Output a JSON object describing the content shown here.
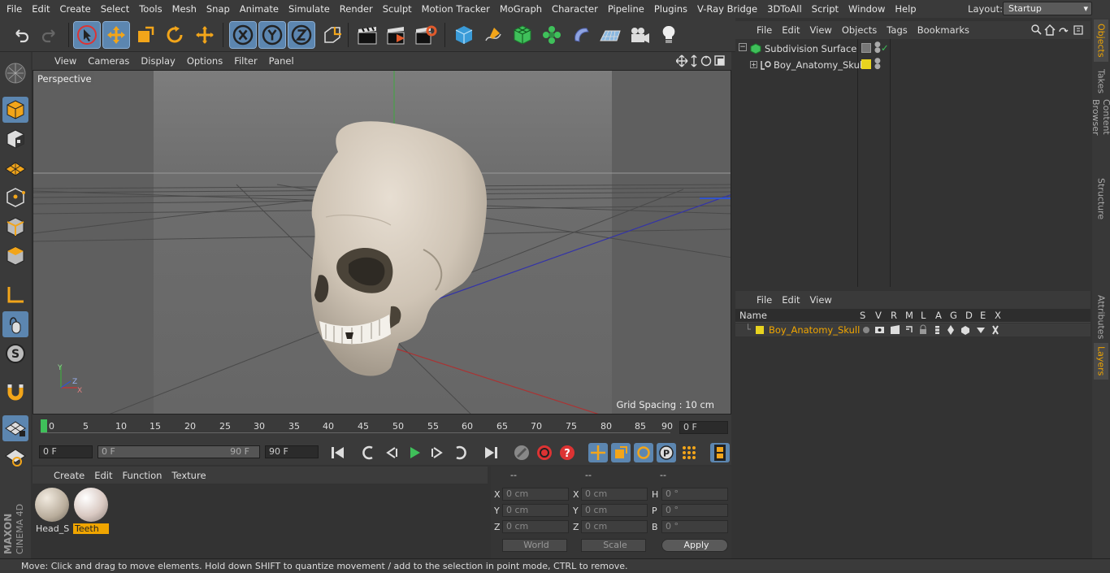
{
  "menubar": {
    "items": [
      "File",
      "Edit",
      "Create",
      "Select",
      "Tools",
      "Mesh",
      "Snap",
      "Animate",
      "Simulate",
      "Render",
      "Sculpt",
      "Motion Tracker",
      "MoGraph",
      "Character",
      "Pipeline",
      "Plugins",
      "V-Ray Bridge",
      "3DToAll",
      "Script",
      "Window",
      "Help"
    ],
    "layout_label": "Layout:",
    "layout_value": "Startup"
  },
  "viewport": {
    "menu": [
      "View",
      "Cameras",
      "Display",
      "Options",
      "Filter",
      "Panel"
    ],
    "camera": "Perspective",
    "grid_spacing": "Grid Spacing : 10 cm"
  },
  "timeline": {
    "ticks": [
      "0",
      "5",
      "10",
      "15",
      "20",
      "25",
      "30",
      "35",
      "40",
      "45",
      "50",
      "55",
      "60",
      "65",
      "70",
      "75",
      "80",
      "85",
      "90"
    ],
    "current_frame": "0 F"
  },
  "transport": {
    "start": "0 F",
    "range_start": "0 F",
    "range_end": "90 F",
    "end": "90 F"
  },
  "materials": {
    "menu": [
      "Create",
      "Edit",
      "Function",
      "Texture"
    ],
    "items": [
      {
        "name": "Head_Sk",
        "selected": false
      },
      {
        "name": "Teeth",
        "selected": true
      }
    ]
  },
  "coords": {
    "headers": [
      "--",
      "--",
      "--"
    ],
    "rows": [
      {
        "l1": "X",
        "v1": "0 cm",
        "l2": "X",
        "v2": "0 cm",
        "l3": "H",
        "v3": "0 °"
      },
      {
        "l1": "Y",
        "v1": "0 cm",
        "l2": "Y",
        "v2": "0 cm",
        "l3": "P",
        "v3": "0 °"
      },
      {
        "l1": "Z",
        "v1": "0 cm",
        "l2": "Z",
        "v2": "0 cm",
        "l3": "B",
        "v3": "0 °"
      }
    ],
    "mode1": "World",
    "mode2": "Scale",
    "apply": "Apply"
  },
  "objects": {
    "menu": [
      "File",
      "Edit",
      "View",
      "Objects",
      "Tags",
      "Bookmarks"
    ],
    "items": [
      {
        "name": "Subdivision Surface"
      },
      {
        "name": "Boy_Anatomy_Skull"
      }
    ]
  },
  "layers": {
    "menu": [
      "File",
      "Edit",
      "View"
    ],
    "columns": [
      "Name",
      "S",
      "V",
      "R",
      "M",
      "L",
      "A",
      "G",
      "D",
      "E",
      "X"
    ],
    "rows": [
      {
        "name": "Boy_Anatomy_Skull"
      }
    ]
  },
  "right_tabs": [
    "Objects",
    "Takes",
    "Content Browser",
    "Structure",
    "Attributes",
    "Layers"
  ],
  "status": "Move: Click and drag to move elements. Hold down SHIFT to quantize movement / add to the selection in point mode, CTRL to remove.",
  "brand": {
    "line1": "MAXON",
    "line2": "CINEMA 4D"
  },
  "colors": {
    "accent": "#5c86b0",
    "highlight": "#f0a500",
    "layer_color": "#e8d31f"
  }
}
